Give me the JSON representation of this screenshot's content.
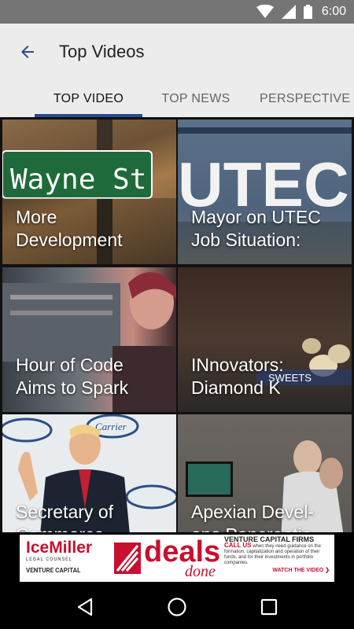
{
  "status_bar": {
    "time": "6:00"
  },
  "app_bar": {
    "title": "Top Videos"
  },
  "tabs": [
    {
      "label": "TOP VIDEO",
      "active": true
    },
    {
      "label": "TOP NEWS",
      "active": false
    },
    {
      "label": "PERSPECTIVE",
      "active": false
    }
  ],
  "videos": [
    {
      "title": "More\nDevelopment",
      "bg_text": "Wayne St"
    },
    {
      "title": "Mayor on UTEC\nJob Situation:",
      "bg_text": "UTEC"
    },
    {
      "title": "Hour of Code\nAims to Spark"
    },
    {
      "title": "INnovators:\nDiamond K",
      "bg_text": "SWEETS"
    },
    {
      "title": "Secretary of\nCommerce",
      "bg_text": "Carrier"
    },
    {
      "title": "Apexian Devel-\nops Pancreatic"
    }
  ],
  "ad": {
    "brand": "IceMiller",
    "brand_sub": "LEGAL COUNSEL",
    "vc_label": "VENTURE CAPITAL",
    "deals": "deals",
    "done": "done",
    "headline": "VENTURE CAPITAL FIRMS",
    "call": "CALL US",
    "body": "when they need guidance on the formation, capitalization and operation of their funds, and for their investments in portfolio companies.",
    "cta": "WATCH THE VIDEO ❯"
  },
  "colors": {
    "accent": "#2b4b8f",
    "status_bar": "#757575",
    "app_bar": "#ececec"
  }
}
